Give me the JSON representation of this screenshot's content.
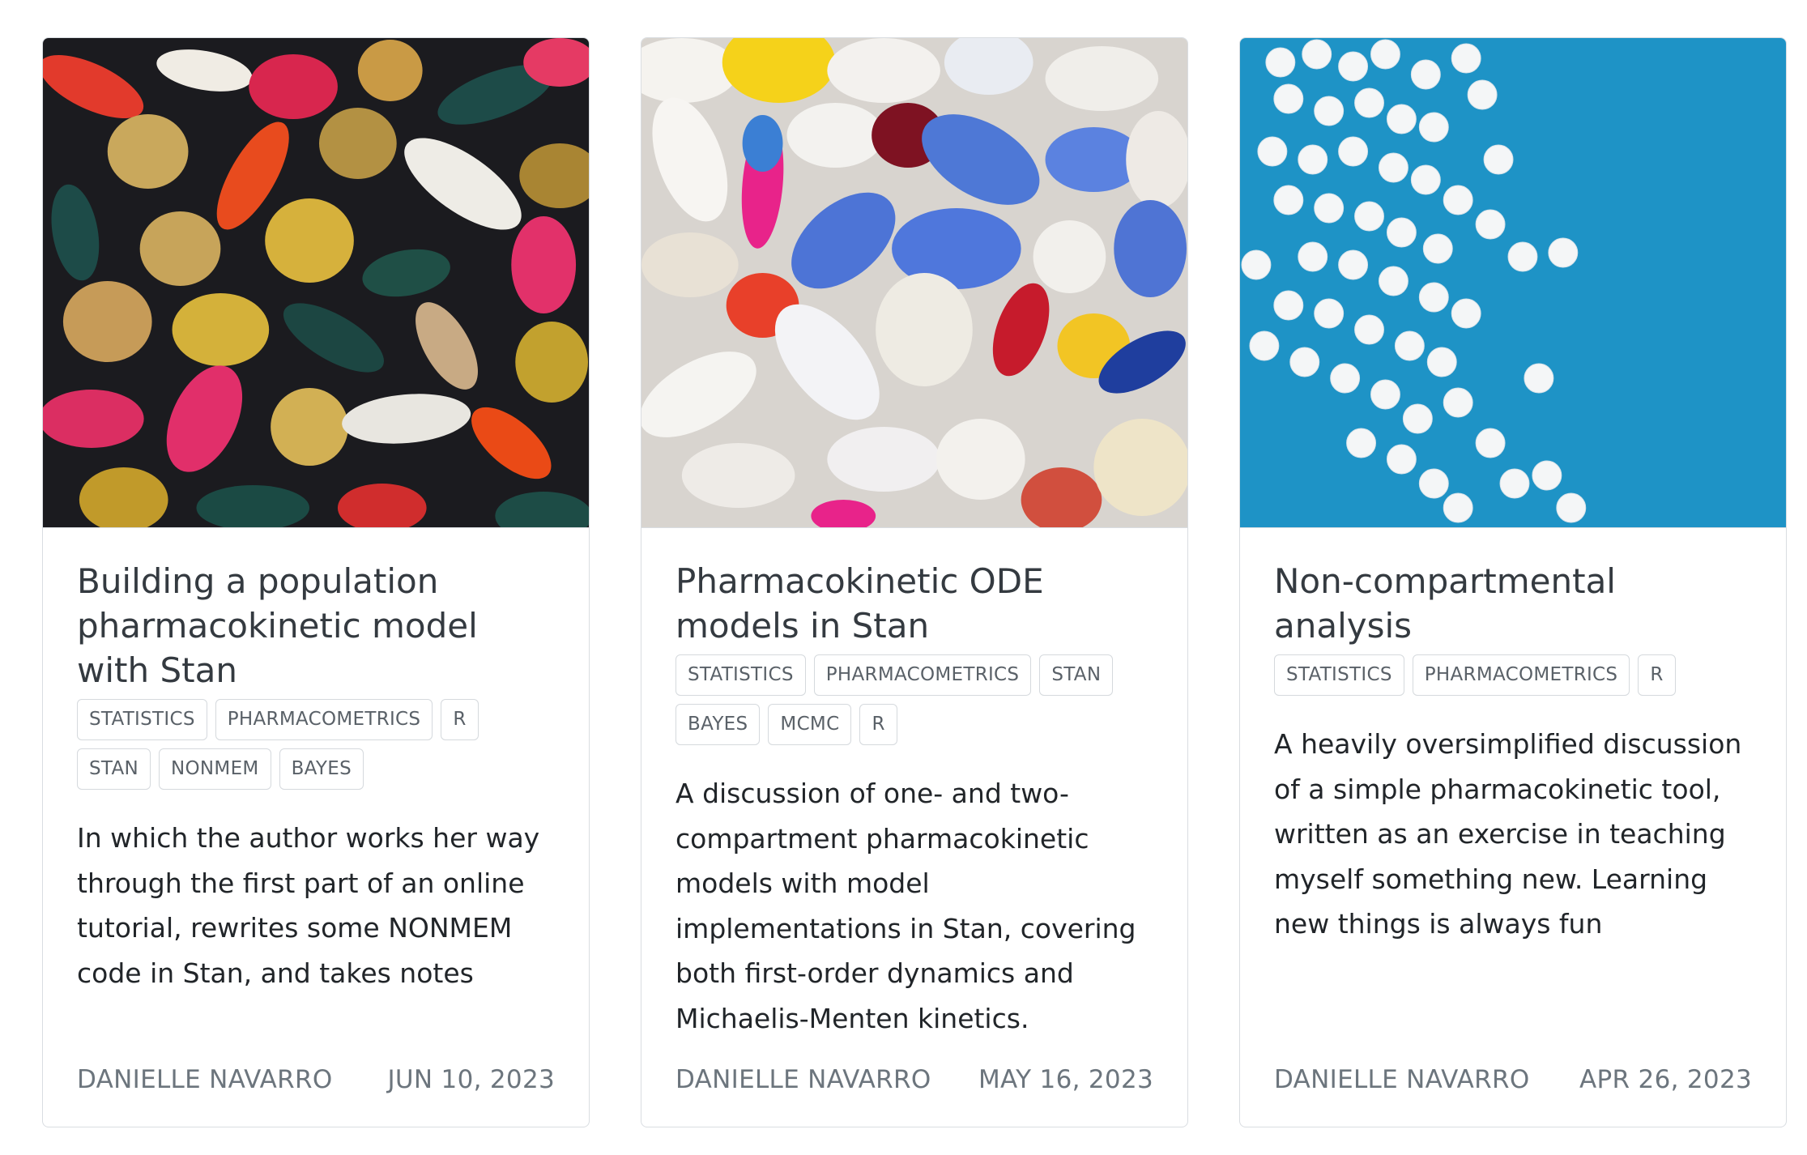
{
  "posts": [
    {
      "image_alt": "Assorted colourful capsules and pills on dark background",
      "title": "Building a population pharmacokinetic model with Stan",
      "tags": [
        "STATISTICS",
        "PHARMACOMETRICS",
        "R",
        "STAN",
        "NONMEM",
        "BAYES"
      ],
      "description": "In which the author works her way through the first part of an online tutorial, rewrites some NONMEM code in Stan, and takes notes",
      "author": "DANIELLE NAVARRO",
      "date": "JUN 10, 2023"
    },
    {
      "image_alt": "Pile of colourful pills and capsules",
      "title": "Pharmacokinetic ODE models in Stan",
      "tags": [
        "STATISTICS",
        "PHARMACOMETRICS",
        "STAN",
        "BAYES",
        "MCMC",
        "R"
      ],
      "description": "A discussion of one- and two-compartment pharmacokinetic models with model implementations in Stan, covering both first-order dynamics and Michaelis-Menten kinetics.",
      "author": "DANIELLE NAVARRO",
      "date": "MAY 16, 2023"
    },
    {
      "image_alt": "White tablets scattered on blue background",
      "title": "Non-compartmental analysis",
      "tags": [
        "STATISTICS",
        "PHARMACOMETRICS",
        "R"
      ],
      "description": "A heavily oversimplified discussion of a simple pharmacokinetic tool, written as an exercise in teaching myself something new. Learning new things is always fun",
      "author": "DANIELLE NAVARRO",
      "date": "APR 26, 2023"
    }
  ],
  "colors": {
    "card_border": "#d9dde1",
    "title": "#343a40",
    "meta": "#6c757d",
    "image3_bg": "#1e93c6"
  }
}
